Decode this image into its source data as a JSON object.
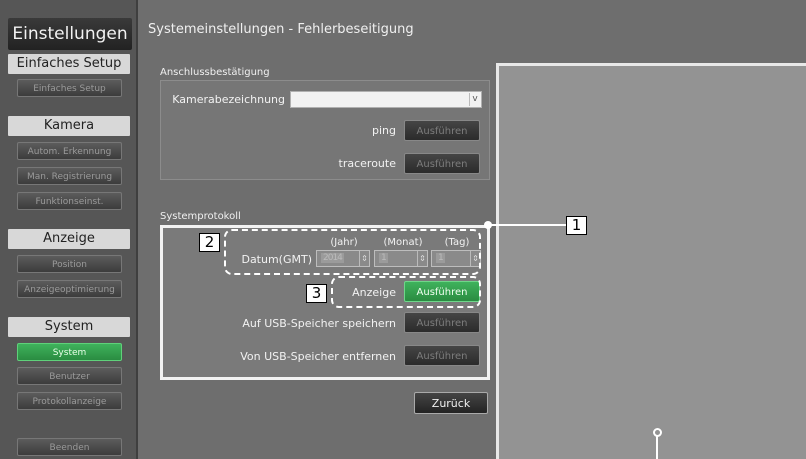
{
  "sidebar": {
    "title": "Einstellungen",
    "sections": [
      {
        "header": "Einfaches Setup",
        "items": [
          "Einfaches Setup"
        ]
      },
      {
        "header": "Kamera",
        "items": [
          "Autom. Erkennung",
          "Man. Registrierung",
          "Funktionseinst."
        ]
      },
      {
        "header": "Anzeige",
        "items": [
          "Position",
          "Anzeigeoptimierung"
        ]
      },
      {
        "header": "System",
        "items": [
          "System",
          "Benutzer",
          "Protokollanzeige"
        ]
      }
    ],
    "active_item": "System",
    "exit_label": "Beenden"
  },
  "header": {
    "title": "Systemeinstellungen - Fehlerbeseitigung"
  },
  "connection": {
    "group_label": "Anschlussbestätigung",
    "camera_label": "Kamerabezeichnung",
    "camera_value": "",
    "ping_label": "ping",
    "traceroute_label": "traceroute",
    "execute_label": "Ausführen"
  },
  "syslog": {
    "group_label": "Systemprotokoll",
    "date_label": "Datum(GMT)",
    "year_head": "(Jahr)",
    "month_head": "(Monat)",
    "day_head": "(Tag)",
    "year_value": "2014",
    "month_value": "1",
    "day_value": "1",
    "display_label": "Anzeige",
    "execute_label": "Ausführen",
    "usb_save_label": "Auf USB-Speicher speichern",
    "usb_remove_label": "Von USB-Speicher entfernen"
  },
  "back_label": "Zurück",
  "callouts": {
    "one": "1",
    "two": "2",
    "three": "3"
  }
}
